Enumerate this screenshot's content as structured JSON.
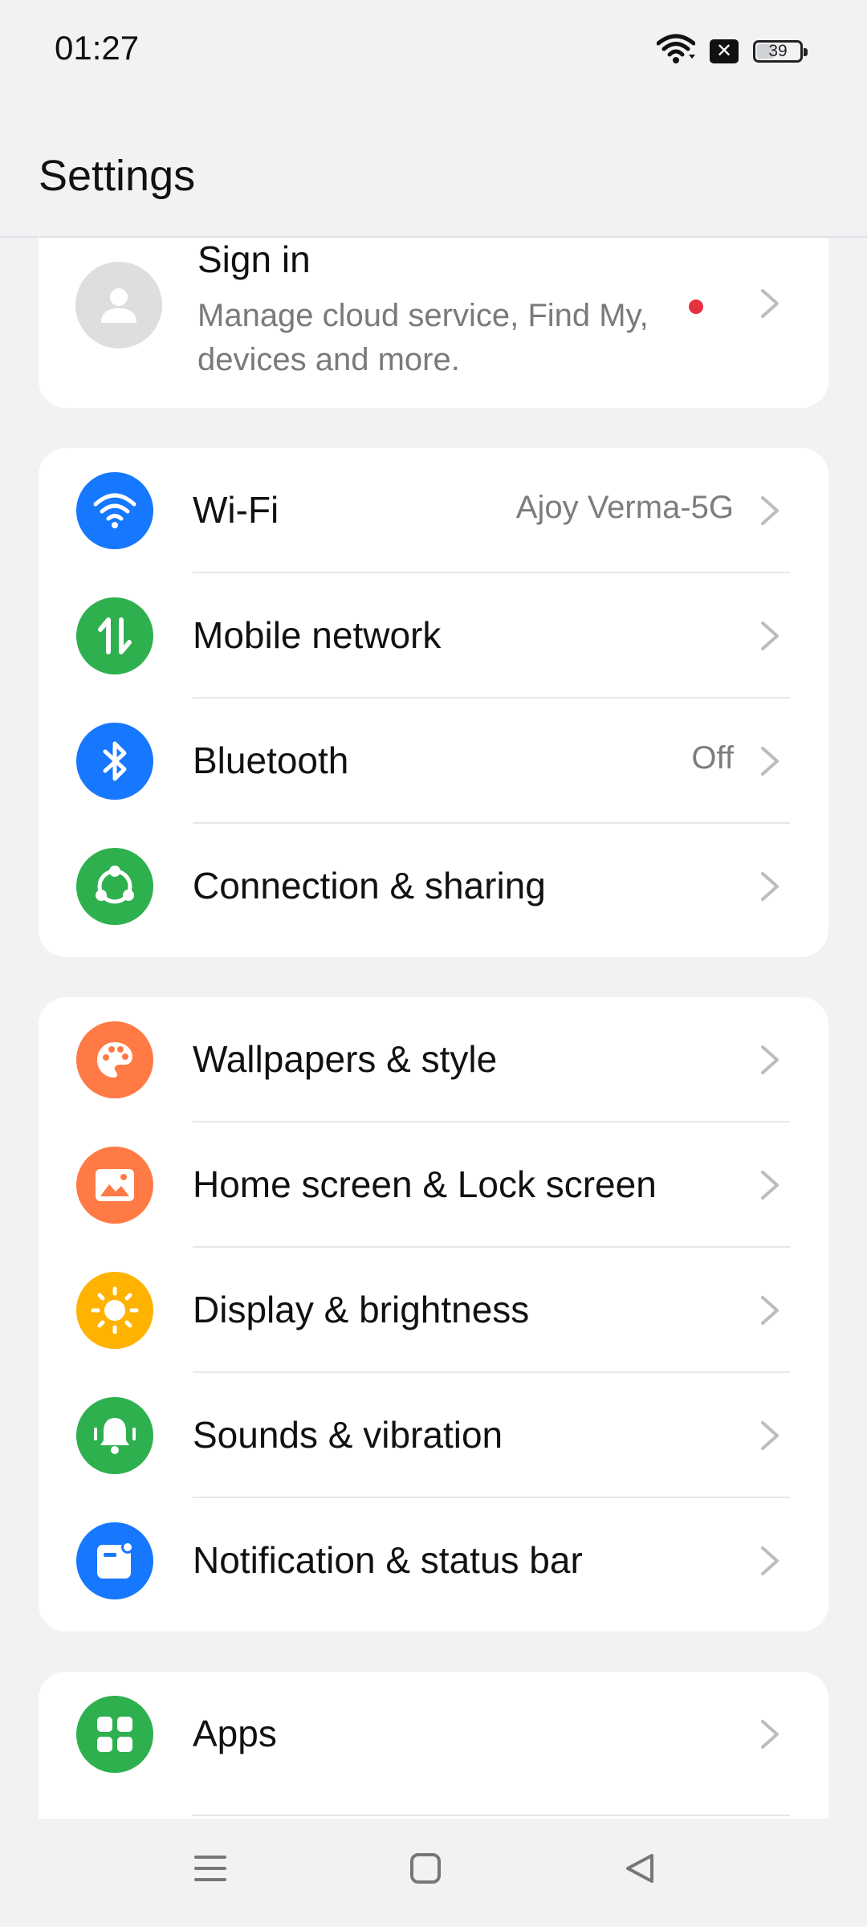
{
  "status_bar": {
    "time": "01:27",
    "battery": "39",
    "icons": [
      "wifi-icon",
      "close-box-icon",
      "battery-icon"
    ]
  },
  "header": {
    "title": "Settings"
  },
  "account": {
    "title": "Sign in",
    "subtitle": "Manage cloud service, Find My, devices and more.",
    "has_notification_dot": true
  },
  "groups": [
    {
      "items": [
        {
          "label": "Wi-Fi",
          "value": "Ajoy Verma-5G",
          "icon": "wifi-icon",
          "color": "#1677ff"
        },
        {
          "label": "Mobile network",
          "value": "",
          "icon": "mobile-data-icon",
          "color": "#2fb04f"
        },
        {
          "label": "Bluetooth",
          "value": "Off",
          "icon": "bluetooth-icon",
          "color": "#1677ff"
        },
        {
          "label": "Connection & sharing",
          "value": "",
          "icon": "share-icon",
          "color": "#2fb04f"
        }
      ]
    },
    {
      "items": [
        {
          "label": "Wallpapers & style",
          "value": "",
          "icon": "palette-icon",
          "color": "#ff7a45"
        },
        {
          "label": "Home screen & Lock screen",
          "value": "",
          "icon": "image-icon",
          "color": "#ff7a45"
        },
        {
          "label": "Display & brightness",
          "value": "",
          "icon": "sun-icon",
          "color": "#ffb300"
        },
        {
          "label": "Sounds & vibration",
          "value": "",
          "icon": "bell-icon",
          "color": "#2fb04f"
        },
        {
          "label": "Notification & status bar",
          "value": "",
          "icon": "notification-icon",
          "color": "#1677ff"
        }
      ]
    },
    {
      "items": [
        {
          "label": "Apps",
          "value": "",
          "icon": "apps-grid-icon",
          "color": "#2fb04f"
        }
      ]
    }
  ],
  "nav_bar": {
    "buttons": [
      "menu-icon",
      "home-icon",
      "back-icon"
    ]
  }
}
